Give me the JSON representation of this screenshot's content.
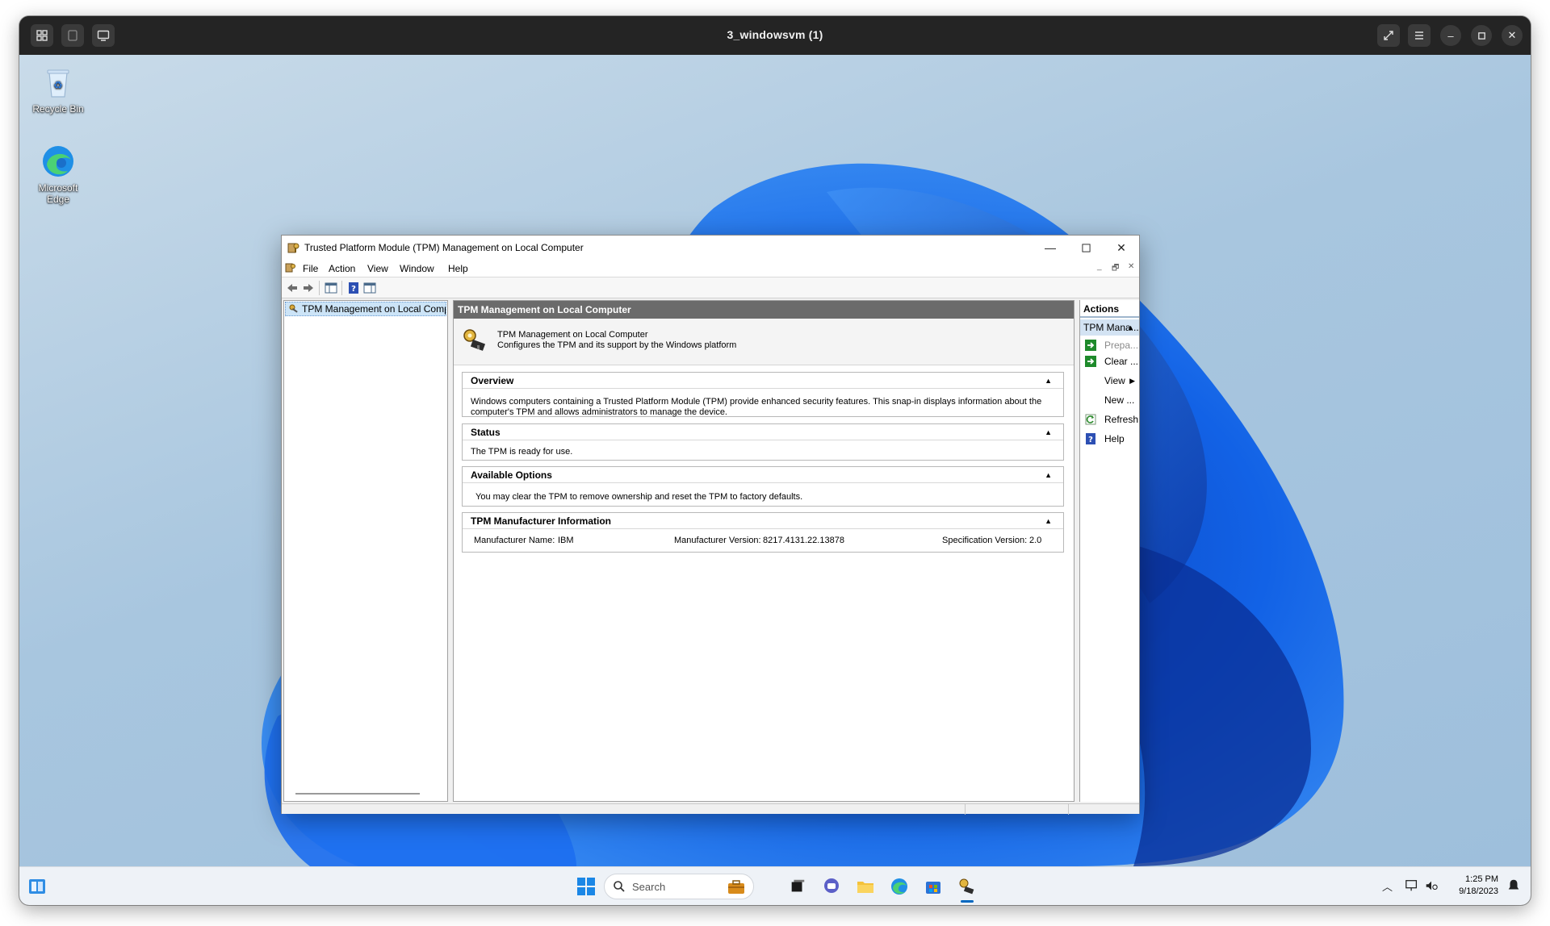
{
  "vm": {
    "title": "3_windowsvm (1)"
  },
  "desktop": {
    "icons": [
      {
        "label": "Recycle Bin",
        "icon": "recycle-bin-icon"
      },
      {
        "label": "Microsoft Edge",
        "icon": "edge-icon"
      }
    ]
  },
  "mmc": {
    "title": "Trusted Platform Module (TPM) Management on Local Computer",
    "menu": [
      "File",
      "Action",
      "View",
      "Window",
      "Help"
    ],
    "tree_item": "TPM Management on Local Comp",
    "center": {
      "header": "TPM Management on Local Computer",
      "intro_title": "TPM Management on Local Computer",
      "intro_desc": "Configures the TPM and its support by the Windows platform",
      "sections": {
        "overview": {
          "title": "Overview",
          "body": "Windows computers containing a Trusted Platform Module (TPM) provide enhanced security features. This snap-in displays information about the computer's TPM and allows administrators to manage the device."
        },
        "status": {
          "title": "Status",
          "body": "The TPM is ready for use."
        },
        "options": {
          "title": "Available Options",
          "body": "You may clear the TPM to remove ownership and reset the TPM to factory defaults."
        },
        "manufacturer": {
          "title": "TPM Manufacturer Information",
          "name_label": "Manufacturer Name:",
          "name_value": "IBM",
          "version_label": "Manufacturer Version:",
          "version_value": "8217.4131.22.13878",
          "spec_label": "Specification Version:",
          "spec_value": "2.0"
        }
      }
    },
    "actions": {
      "title": "Actions",
      "group": "TPM Mana...",
      "items": [
        {
          "label": "Prepa...",
          "disabled": true,
          "icon": "green-arrow-icon"
        },
        {
          "label": "Clear ...",
          "disabled": false,
          "icon": "green-arrow-icon"
        },
        {
          "label": "View",
          "submenu": true
        },
        {
          "label": "New ..."
        },
        {
          "label": "Refresh",
          "icon": "refresh-icon"
        },
        {
          "label": "Help",
          "icon": "help-icon"
        }
      ]
    }
  },
  "taskbar": {
    "search_placeholder": "Search",
    "time": "1:25 PM",
    "date": "9/18/2023"
  },
  "colors": {
    "accent": "#0067c0",
    "header_gray": "#6b6b6b",
    "selection": "#cce4f7"
  }
}
